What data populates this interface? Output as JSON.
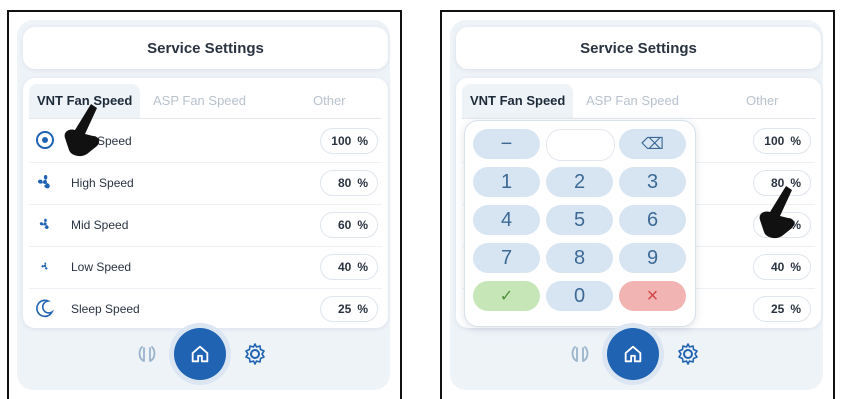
{
  "header": {
    "title": "Service Settings"
  },
  "tabs": [
    {
      "label": "VNT Fan Speed",
      "active": true
    },
    {
      "label": "ASP Fan Speed",
      "active": false
    },
    {
      "label": "Other",
      "active": false
    }
  ],
  "left_rows": [
    {
      "label": "Max Speed",
      "value": "100",
      "unit": "%",
      "icon": "fan-max-icon"
    },
    {
      "label": "High Speed",
      "value": "80",
      "unit": "%",
      "icon": "fan-high-icon"
    },
    {
      "label": "Mid Speed",
      "value": "60",
      "unit": "%",
      "icon": "fan-mid-icon"
    },
    {
      "label": "Low Speed",
      "value": "40",
      "unit": "%",
      "icon": "fan-low-icon"
    },
    {
      "label": "Sleep Speed",
      "value": "25",
      "unit": "%",
      "icon": "moon-icon"
    }
  ],
  "right_values": [
    "100",
    "80",
    "60",
    "40",
    "25"
  ],
  "unit": "%",
  "keypad": {
    "minus": "−",
    "backspace": "⌫",
    "digits": [
      "1",
      "2",
      "3",
      "4",
      "5",
      "6",
      "7",
      "8",
      "9",
      "0"
    ],
    "ok": "✓",
    "cancel": "×"
  },
  "nav": {
    "left_icon": "fan-icon",
    "home_icon": "home-icon",
    "right_icon": "gear-icon"
  },
  "colors": {
    "accent": "#1f63b2",
    "key": "#d7e5f2",
    "ok": "#c6e6b8",
    "cancel": "#f2b3b3"
  }
}
